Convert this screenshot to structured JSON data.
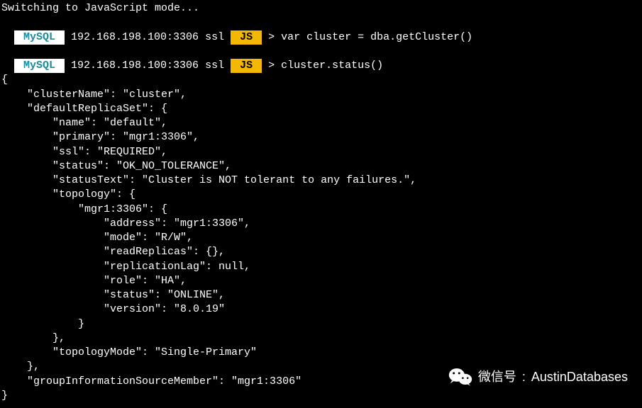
{
  "header_msg": "Switching to JavaScript mode...",
  "prompt": {
    "mysql_badge": " MySQL ",
    "host": " 192.168.198.100:3306 ssl ",
    "js_badge": " JS ",
    "gt": " > "
  },
  "commands": {
    "c1": "var cluster = dba.getCluster()",
    "c2": "cluster.status()"
  },
  "json_lines": {
    "l_open": "{",
    "l_clusterName": "    \"clusterName\": \"cluster\", ",
    "l_drs_open": "    \"defaultReplicaSet\": {",
    "l_name": "        \"name\": \"default\", ",
    "l_primary": "        \"primary\": \"mgr1:3306\", ",
    "l_ssl": "        \"ssl\": \"REQUIRED\", ",
    "l_status": "        \"status\": \"OK_NO_TOLERANCE\", ",
    "l_statusText": "        \"statusText\": \"Cluster is NOT tolerant to any failures.\", ",
    "l_topo_open": "        \"topology\": {",
    "l_node_open": "            \"mgr1:3306\": {",
    "l_address": "                \"address\": \"mgr1:3306\", ",
    "l_mode": "                \"mode\": \"R/W\", ",
    "l_readReplicas": "                \"readReplicas\": {},",
    "l_replag": "                \"replicationLag\": null, ",
    "l_role": "                \"role\": \"HA\", ",
    "l_nstatus": "                \"status\": \"ONLINE\", ",
    "l_version": "                \"version\": \"8.0.19\"",
    "l_node_close": "            }",
    "l_topo_close": "        }, ",
    "l_topomode": "        \"topologyMode\": \"Single-Primary\"",
    "l_drs_close": "    }, ",
    "l_gism": "    \"groupInformationSourceMember\": \"mgr1:3306\"",
    "l_close": "}"
  },
  "watermark": {
    "label": "微信号",
    "colon": ": ",
    "value": "AustinDatabases"
  },
  "chart_data": {
    "type": "table",
    "title": "MySQL InnoDB Cluster status() output",
    "data": {
      "clusterName": "cluster",
      "defaultReplicaSet": {
        "name": "default",
        "primary": "mgr1:3306",
        "ssl": "REQUIRED",
        "status": "OK_NO_TOLERANCE",
        "statusText": "Cluster is NOT tolerant to any failures.",
        "topology": {
          "mgr1:3306": {
            "address": "mgr1:3306",
            "mode": "R/W",
            "readReplicas": {},
            "replicationLag": null,
            "role": "HA",
            "status": "ONLINE",
            "version": "8.0.19"
          }
        },
        "topologyMode": "Single-Primary"
      },
      "groupInformationSourceMember": "mgr1:3306"
    }
  }
}
